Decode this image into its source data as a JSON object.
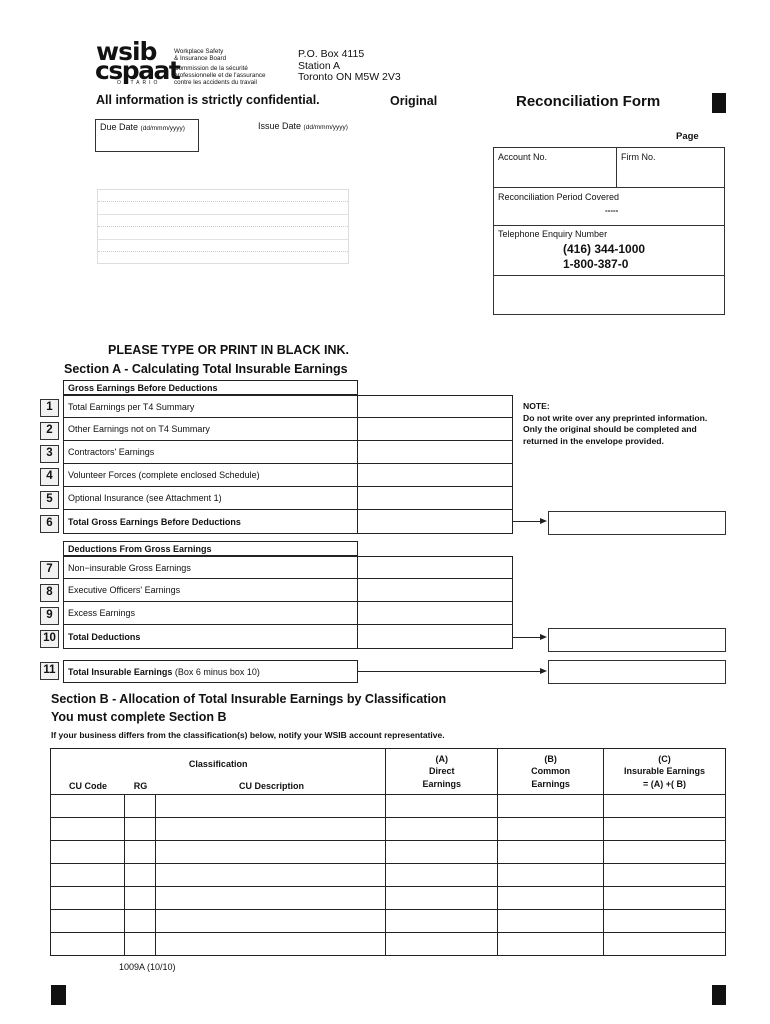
{
  "header": {
    "logo_line1": "wsib",
    "logo_line2": "cspaat",
    "logo_line3": "ONTARIO",
    "board_en_1": "Workplace Safety",
    "board_en_2": "& Insurance Board",
    "board_fr_1": "Commission de la sécurité",
    "board_fr_2": "professionnelle et de l'assurance",
    "board_fr_3": "contre les accidents du travail",
    "address_1": "P.O. Box 4115",
    "address_2": "Station A",
    "address_3": "Toronto ON  M5W 2V3",
    "confidential": "All information is strictly confidential.",
    "copy_type": "Original",
    "form_title": "Reconciliation Form"
  },
  "dates": {
    "due_label": "Due Date",
    "due_format": "(dd/mmm/yyyy)",
    "issue_label": "Issue Date",
    "issue_format": "(dd/mmm/yyyy)"
  },
  "info": {
    "page_label": "Page",
    "account_label": "Account No.",
    "firm_label": "Firm No.",
    "period_label": "Reconciliation Period Covered",
    "period_value": "-----",
    "phone_label": "Telephone Enquiry Number",
    "phone_1": "(416) 344-1000",
    "phone_2": "1-800-387-0"
  },
  "instructions": {
    "ink": "PLEASE TYPE OR PRINT IN BLACK INK.",
    "section_a_title": "Section A - Calculating Total Insurable Earnings",
    "note_title": "NOTE:",
    "note_body": "Do not write over any preprinted information.  Only the original should be completed and returned in the envelope provided."
  },
  "section_a": {
    "gross_header": "Gross Earnings Before Deductions",
    "deductions_header": "Deductions From Gross Earnings",
    "lines": [
      {
        "num": "1",
        "label": "Total Earnings per T4 Summary"
      },
      {
        "num": "2",
        "label": "Other Earnings not on T4 Summary"
      },
      {
        "num": "3",
        "label": "Contractors' Earnings"
      },
      {
        "num": "4",
        "label": "Volunteer Forces (complete enclosed Schedule)"
      },
      {
        "num": "5",
        "label": "Optional Insurance  (see Attachment 1)"
      },
      {
        "num": "6",
        "label": "Total Gross Earnings Before Deductions"
      },
      {
        "num": "7",
        "label": "Non−insurable Gross Earnings"
      },
      {
        "num": "8",
        "label": "Executive Officers' Earnings"
      },
      {
        "num": "9",
        "label": "Excess Earnings"
      },
      {
        "num": "10",
        "label": "Total Deductions"
      },
      {
        "num": "11",
        "label_bold": "Total Insurable Earnings",
        "label_rest": " (Box 6 minus box 10)"
      }
    ]
  },
  "section_b": {
    "title": "Section B - Allocation of Total Insurable Earnings by Classification",
    "subtitle": "You must complete Section B",
    "instruction": "If your business differs from the classification(s) below, notify your WSIB account representative.",
    "classification_label": "Classification",
    "columns": {
      "cu_code": "CU Code",
      "rg": "RG",
      "cu_description": "CU Description",
      "a_letter": "(A)",
      "a_line1": "Direct",
      "a_line2": "Earnings",
      "b_letter": "(B)",
      "b_line1": "Common",
      "b_line2": "Earnings",
      "c_letter": "(C)",
      "c_line1": "Insurable Earnings",
      "c_line2": "= (A) +( B)"
    },
    "row_count": 7
  },
  "footer": {
    "form_code": "1009A (10/10)"
  }
}
